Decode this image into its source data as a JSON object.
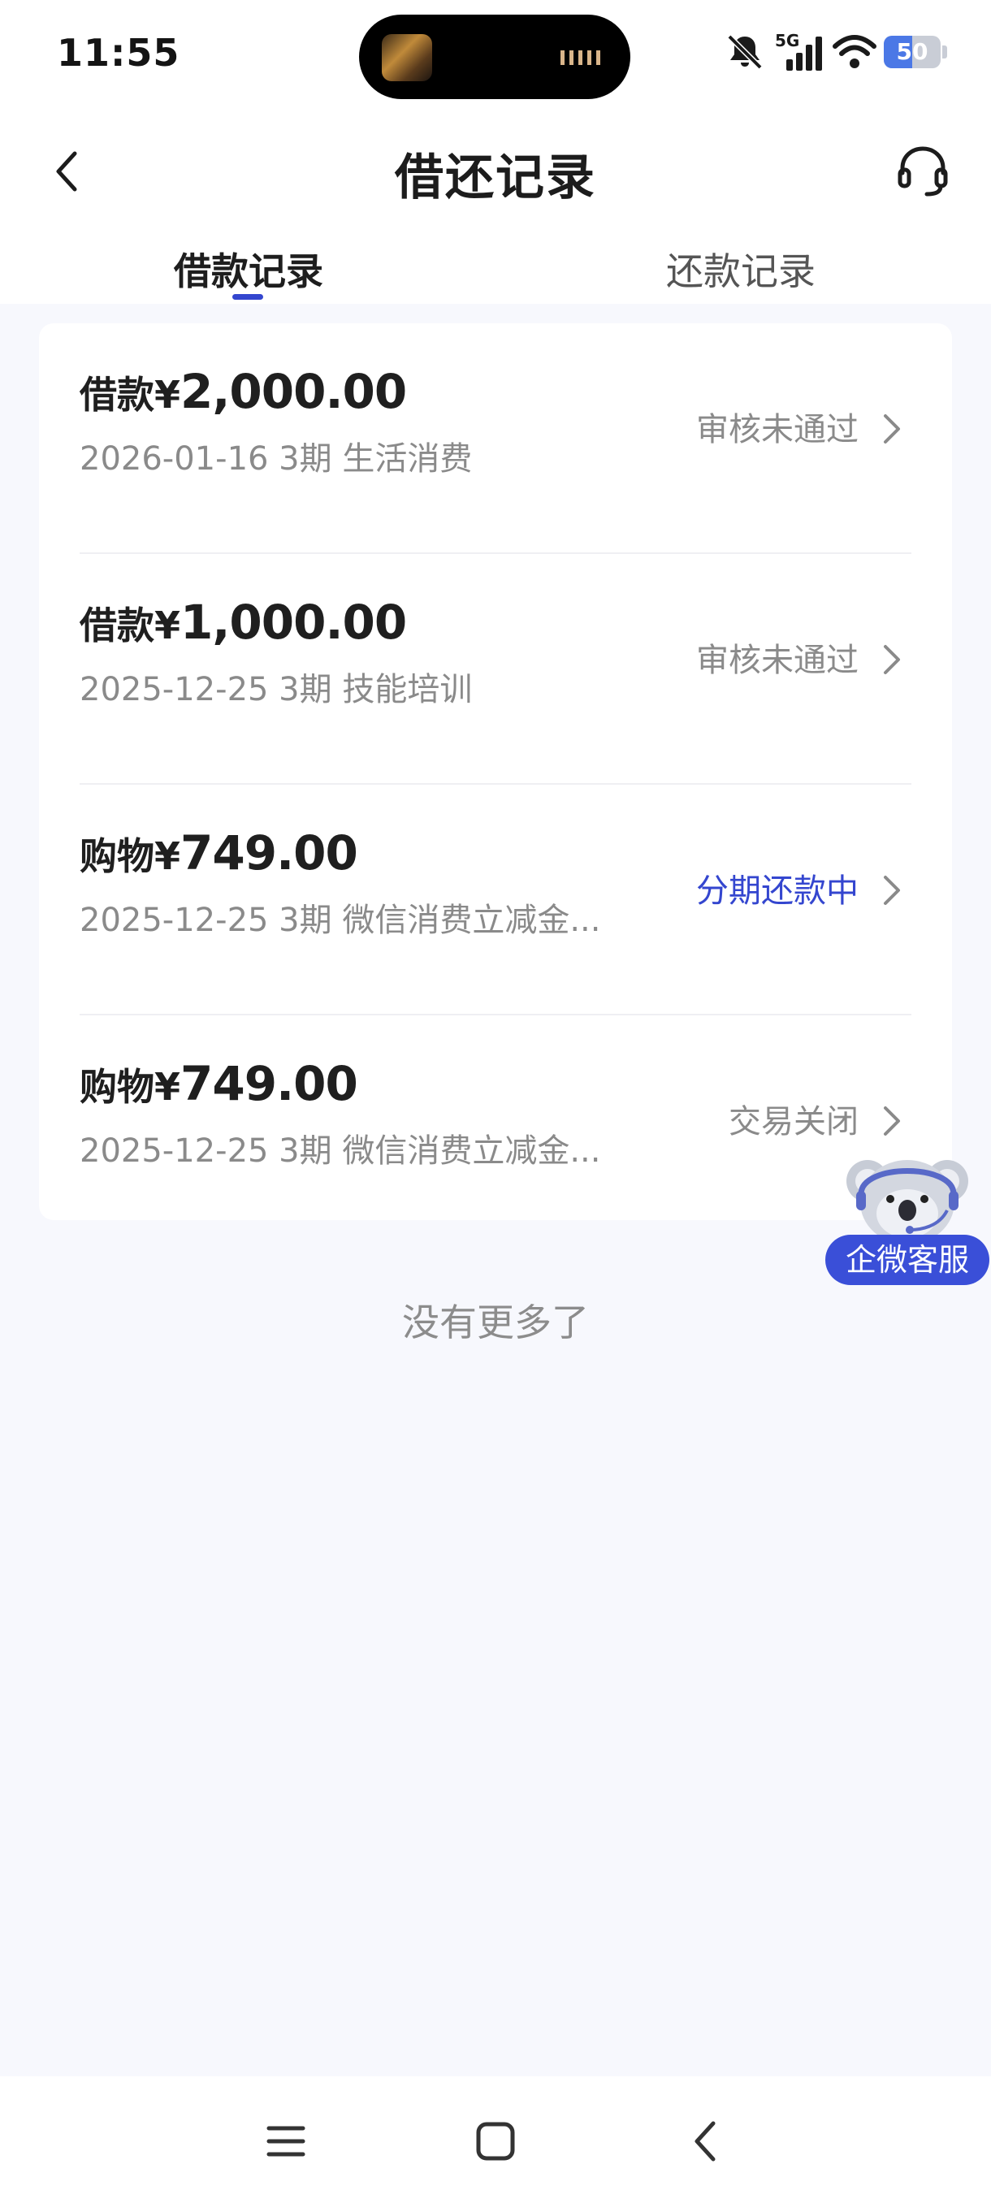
{
  "status_bar": {
    "time": "11:55",
    "network": "5G",
    "battery": "50",
    "battery_level": 0.5
  },
  "header": {
    "title": "借还记录",
    "back_icon": "chevron-left-icon",
    "support_icon": "headset-icon"
  },
  "tabs": [
    {
      "label": "借款记录",
      "active": true
    },
    {
      "label": "还款记录",
      "active": false
    }
  ],
  "records": [
    {
      "prefix": "借款¥",
      "amount": "2,000.00",
      "details": "2026-01-16 3期  生活消费",
      "status": "审核未通过",
      "status_active": false
    },
    {
      "prefix": "借款¥",
      "amount": "1,000.00",
      "details": "2025-12-25 3期  技能培训",
      "status": "审核未通过",
      "status_active": false
    },
    {
      "prefix": "购物¥",
      "amount": "749.00",
      "details": "2025-12-25 3期  微信消费立减金...",
      "status": "分期还款中",
      "status_active": true
    },
    {
      "prefix": "购物¥",
      "amount": "749.00",
      "details": "2025-12-25 3期  微信消费立减金...",
      "status": "交易关闭",
      "status_active": false
    }
  ],
  "footer_text": "没有更多了",
  "floating_service": {
    "label": "企微客服",
    "icon": "koala-mascot-icon"
  },
  "colors": {
    "accent": "#3446cf",
    "background": "#f7f8fd",
    "muted_text": "#8a8a8a"
  }
}
